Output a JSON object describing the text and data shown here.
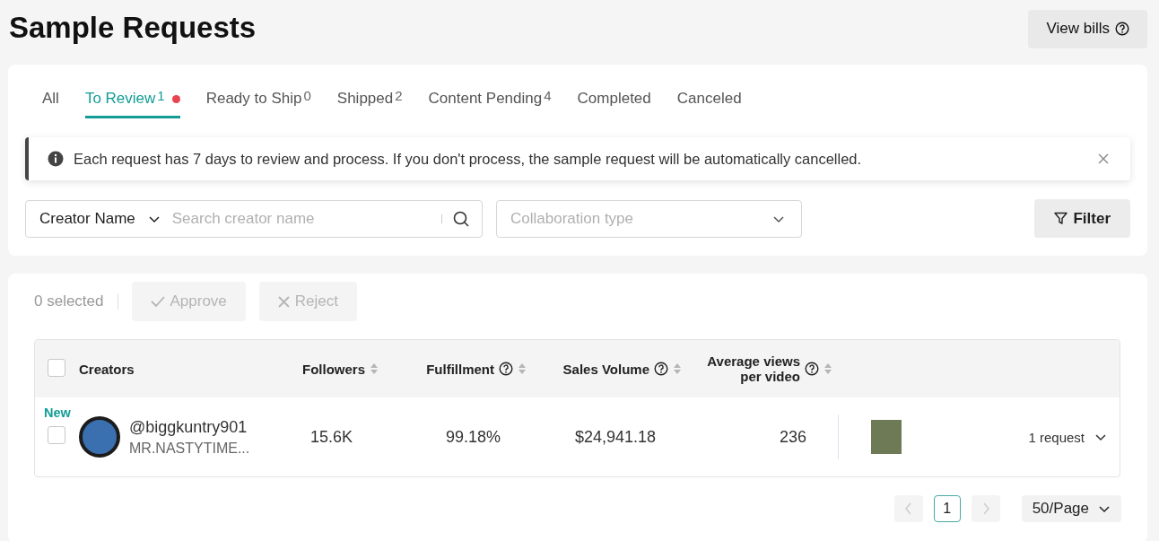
{
  "page_title": "Sample Requests",
  "view_bills_button": {
    "label": "View bills"
  },
  "tabs": [
    {
      "label": "All",
      "selected": false,
      "dot": false
    },
    {
      "label": "To Review",
      "count": "1",
      "selected": true,
      "dot": true
    },
    {
      "label": "Ready to Ship",
      "count": "0",
      "selected": false,
      "dot": false
    },
    {
      "label": "Shipped",
      "count": "2",
      "selected": false,
      "dot": false
    },
    {
      "label": "Content Pending",
      "count": "4",
      "selected": false,
      "dot": false
    },
    {
      "label": "Completed",
      "selected": false,
      "dot": false
    },
    {
      "label": "Canceled",
      "selected": false,
      "dot": false
    }
  ],
  "notice": {
    "text": "Each request has 7 days to review and process. If you don't process, the sample request will be automatically cancelled."
  },
  "search": {
    "field_selector": "Creator Name",
    "placeholder": "Search creator name"
  },
  "collaboration_select": {
    "placeholder": "Collaboration type"
  },
  "filter_button": {
    "label": "Filter"
  },
  "bulk_actions": {
    "selected_count": "0 selected",
    "buttons": [
      {
        "kind": "approve",
        "label": "Approve",
        "disabled": true
      },
      {
        "kind": "reject",
        "label": "Reject",
        "disabled": true
      }
    ]
  },
  "table": {
    "select_all_checked": false,
    "columns": [
      {
        "label": "Creators",
        "help": false,
        "sortable": false
      },
      {
        "label": "Followers",
        "help": false,
        "sortable": true
      },
      {
        "label": "Fulfillment",
        "help": true,
        "sortable": true
      },
      {
        "label": "Sales Volume",
        "help": true,
        "sortable": true
      },
      {
        "label": "Average views per video",
        "help": true,
        "sortable": true
      }
    ],
    "rows": [
      {
        "badge": "New",
        "checked": false,
        "handle": "@biggkuntry901",
        "name": "MR.NASTYTIME...",
        "followers": "15.6K",
        "fulfillment": "99.18%",
        "sales_volume": "$24,941.18",
        "average_views": "236",
        "requests": "1 request"
      }
    ]
  },
  "pagination": {
    "pages": [
      {
        "label": "1",
        "selected": true
      }
    ],
    "prev_disabled": true,
    "next_disabled": true,
    "page_size": "50/Page"
  }
}
